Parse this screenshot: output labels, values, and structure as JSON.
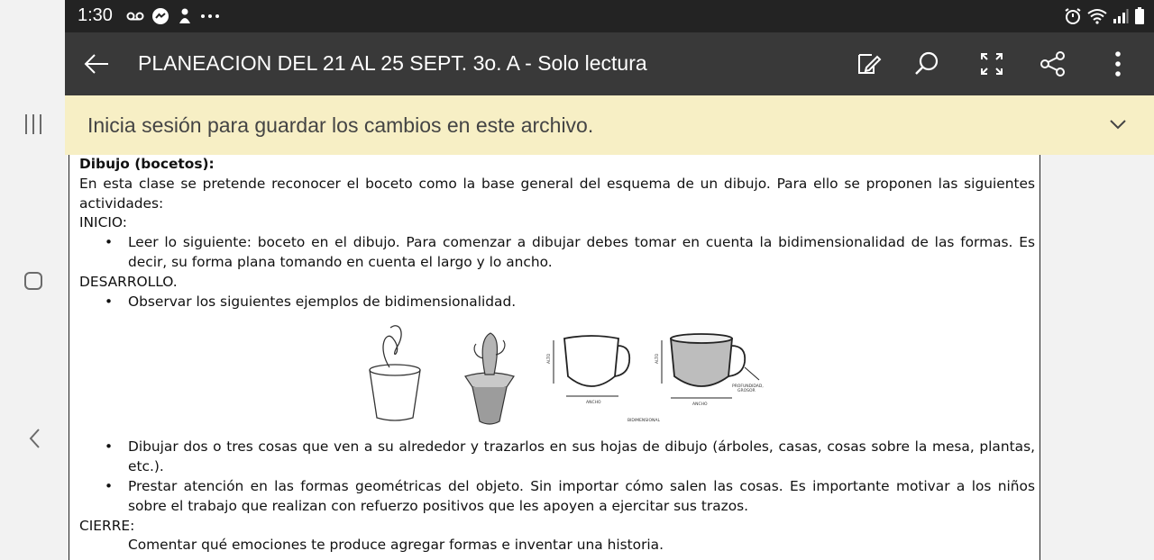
{
  "status_bar": {
    "time": "1:30"
  },
  "toolbar": {
    "title": "PLANEACION DEL 21 AL 25 SEPT. 3o. A - Solo lectura"
  },
  "signin_banner": {
    "text": "Inicia sesión para guardar los cambios en este archivo."
  },
  "document": {
    "heading": "Dibujo (bocetos):",
    "intro": "En esta clase se pretende reconocer el boceto como la base general del esquema de un dibujo. Para ello se proponen las siguientes actividades:",
    "inicio": {
      "label": "INICIO:",
      "bullets": [
        "Leer lo siguiente: boceto en el dibujo. Para comenzar a dibujar debes tomar en cuenta la bidimensionalidad de las formas. Es decir, su forma plana tomando en cuenta el largo y lo ancho."
      ]
    },
    "desarrollo": {
      "label": "DESARROLLO.",
      "bullets": [
        "Observar los siguientes ejemplos de bidimensionalidad.",
        "Dibujar dos o tres  cosas que ven a su alrededor y trazarlos en sus hojas de dibujo (árboles, casas, cosas sobre la mesa, plantas, etc.).",
        "Prestar atención en las formas geométricas del objeto. Sin importar cómo salen las cosas. Es importante motivar a los niños sobre el trabajo que realizan con refuerzo positivos que les apoyen a ejercitar sus trazos."
      ]
    },
    "cierre": {
      "label": "CIERRE:",
      "text": "Comentar qué emociones te produce agregar formas e inventar una historia."
    },
    "figure_labels": {
      "alto_1": "ALTO",
      "ancho_1": "ANCHO",
      "alto_2": "ALTO",
      "ancho_2": "ANCHO",
      "profundidad": "PROFUNDIDAD,",
      "grosor": "GROSOR",
      "caption": "BIDIMENSIONAL"
    }
  }
}
